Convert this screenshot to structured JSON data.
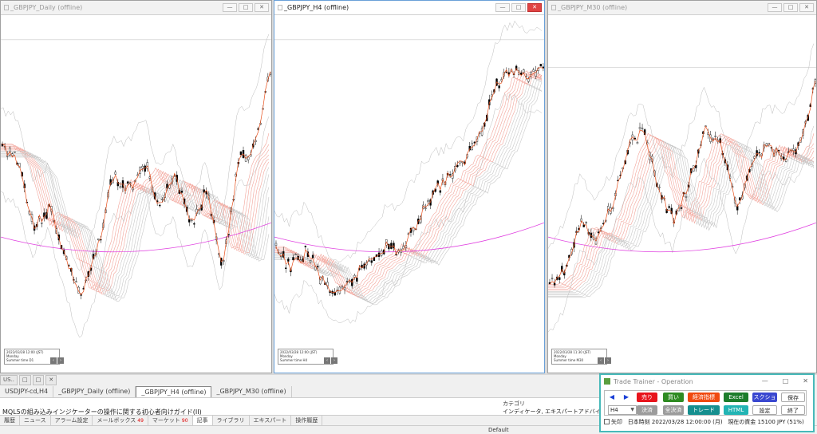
{
  "windows": [
    {
      "title": "_GBPJPY_Daily (offline)",
      "info": [
        "2022/03/28 12:00 (JST)",
        "Monday",
        "Summer time   D1"
      ]
    },
    {
      "title": "_GBPJPY_H4 (offline)",
      "info": [
        "2022/03/28 12:00 (JST)",
        "Monday",
        "Summer time   H4"
      ]
    },
    {
      "title": "_GBPJPY_M30 (offline)",
      "info": [
        "2022/03/28 11:30 (JST)",
        "Monday",
        "Summer time   M30"
      ]
    }
  ],
  "mini_windows": [
    "US..",
    "□",
    "□",
    "✕"
  ],
  "doc_tabs": [
    "USDJPY-cd,H4",
    "_GBPJPY_Daily (offline)",
    "_GBPJPY_H4 (offline)",
    "_GBPJPY_M30 (offline)"
  ],
  "articles": {
    "category_header": "カテゴリ",
    "row_title": "MQL5の組み込みインジケーターの操作に関する初心者向けガイド(II)",
    "row_category": "インディケータ, エキスパートアドバイザー, インデ"
  },
  "terminal_tabs": [
    {
      "label": "履歴",
      "badge": ""
    },
    {
      "label": "ニュース",
      "badge": ""
    },
    {
      "label": "アラーム設定",
      "badge": ""
    },
    {
      "label": "メールボックス",
      "badge": "49"
    },
    {
      "label": "マーケット",
      "badge": "90"
    },
    {
      "label": "記事",
      "badge": ""
    },
    {
      "label": "ライブラリ",
      "badge": ""
    },
    {
      "label": "エキスパート",
      "badge": ""
    },
    {
      "label": "操作履歴",
      "badge": ""
    }
  ],
  "status": {
    "profile": "Default"
  },
  "trade_trainer": {
    "title": "Trade Trainer - Operation",
    "controls": [
      "—",
      "□",
      "✕"
    ],
    "prev": "◀",
    "next": "▶",
    "timeframe": "H4",
    "buttons": {
      "sell": "売り",
      "buy": "買い",
      "indicators": "経済指標",
      "excel": "Excel",
      "screenshot": "スクショ",
      "save": "保存",
      "settle": "決済",
      "settle_all": "全決済",
      "trade": "トレード",
      "html": "HTML",
      "settings": "設定",
      "exit": "終了"
    },
    "colors": {
      "sell": "#e8141c",
      "buy": "#2e8b22",
      "indicators": "#f04a10",
      "excel": "#1d7d2c",
      "screenshot": "#3a48d0",
      "trade": "#168f8f",
      "html": "#22b4b4",
      "gray": "#9c9c9c"
    },
    "arrow_label": "矢印",
    "time_label": "日本時刻",
    "time_value": "2022/03/28 12:00:00 (月)",
    "balance_label": "現在の資金",
    "balance_value": "15100 JPY (51%)"
  }
}
